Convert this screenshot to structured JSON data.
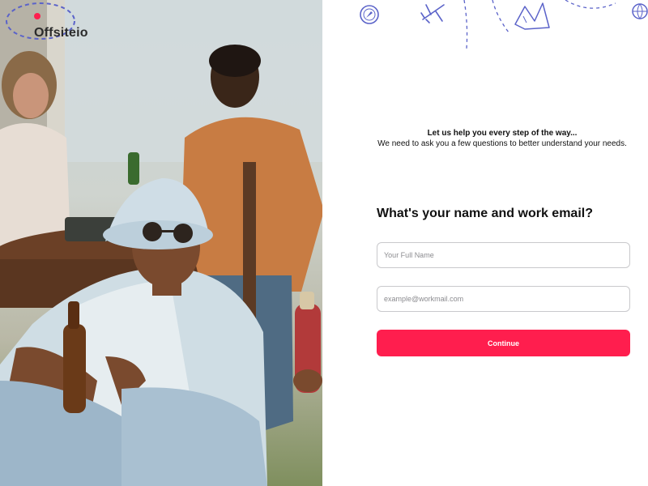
{
  "brand": {
    "logo_text": "Offsiteio"
  },
  "intro": {
    "headline": "Let us help you every step of the way...",
    "subtext": "We need to ask you a few questions to better understand your needs."
  },
  "form": {
    "question": "What's your name and work email?",
    "name_field": {
      "value": "",
      "placeholder": "Your Full Name"
    },
    "email_field": {
      "value": "",
      "placeholder": "example@workmail.com"
    },
    "continue_label": "Continue"
  },
  "colors": {
    "accent": "#ff1e4e",
    "doodle": "#5b63c9",
    "input_border": "#c9c9cc"
  },
  "icons": [
    "compass-icon",
    "airplane-icon",
    "map-icon",
    "globe-icon"
  ]
}
